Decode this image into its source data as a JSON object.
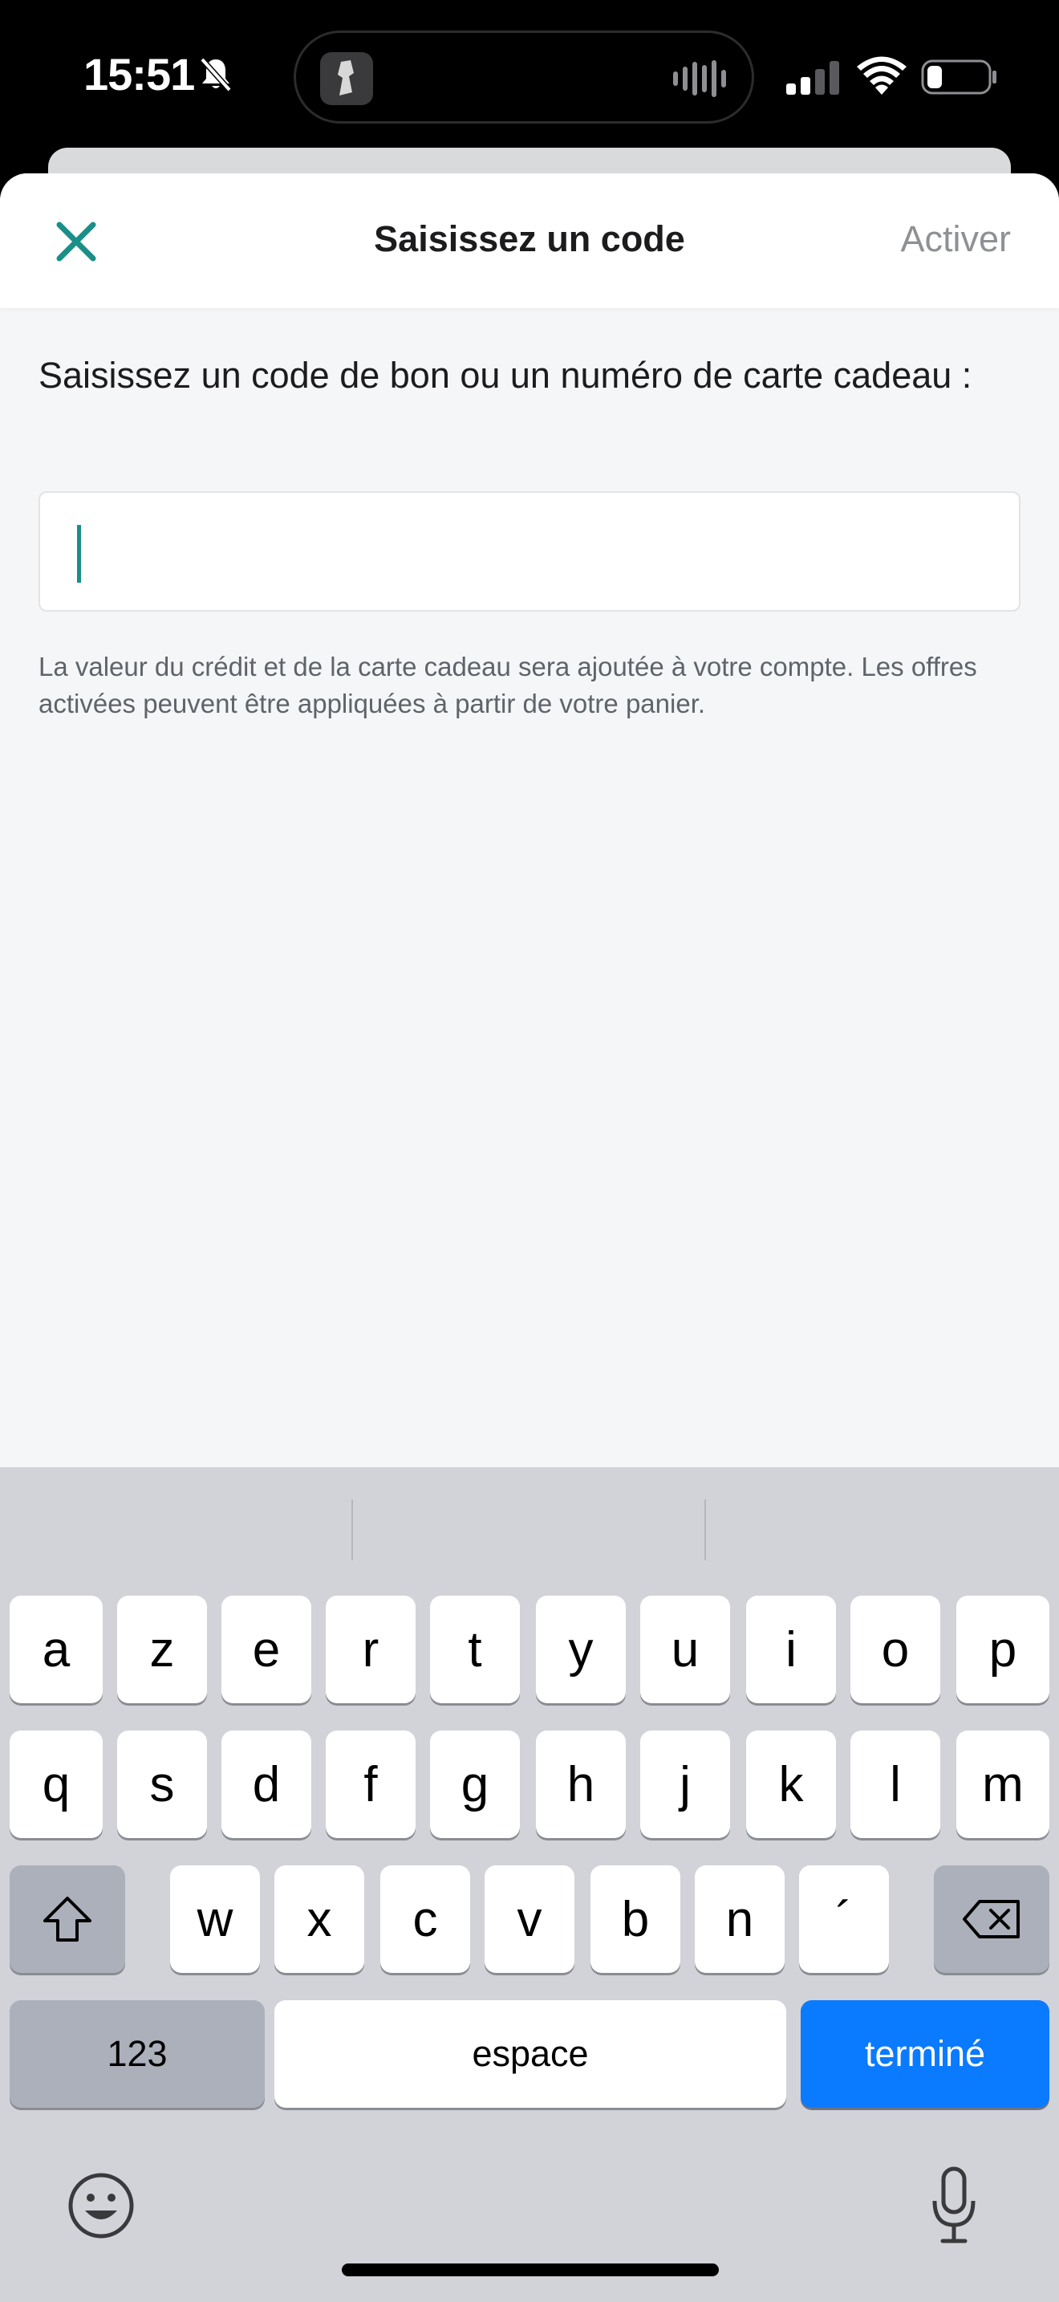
{
  "status_bar": {
    "time": "15:51",
    "icons": [
      "bell-slash-icon",
      "music-album-art",
      "audio-waveform-icon",
      "cellular-signal-icon",
      "wifi-icon",
      "battery-icon"
    ]
  },
  "header": {
    "title": "Saisissez un code",
    "action_label": "Activer",
    "close_icon": "close-icon",
    "accent_color": "#1a8f88"
  },
  "form": {
    "prompt": "Saisissez un code de bon ou un numéro de carte cadeau :",
    "code_value": "",
    "help_text": "La valeur du crédit et de la carte cadeau sera ajoutée à votre compte. Les offres activées peuvent être appliquées à partir de votre panier."
  },
  "keyboard": {
    "row1": [
      "a",
      "z",
      "e",
      "r",
      "t",
      "y",
      "u",
      "i",
      "o",
      "p"
    ],
    "row2": [
      "q",
      "s",
      "d",
      "f",
      "g",
      "h",
      "j",
      "k",
      "l",
      "m"
    ],
    "row3": [
      "w",
      "x",
      "c",
      "v",
      "b",
      "n",
      "´"
    ],
    "numbers_label": "123",
    "space_label": "espace",
    "done_label": "terminé",
    "done_color": "#0a7aff",
    "icons": [
      "shift-icon",
      "backspace-icon",
      "emoji-icon",
      "microphone-icon"
    ]
  }
}
